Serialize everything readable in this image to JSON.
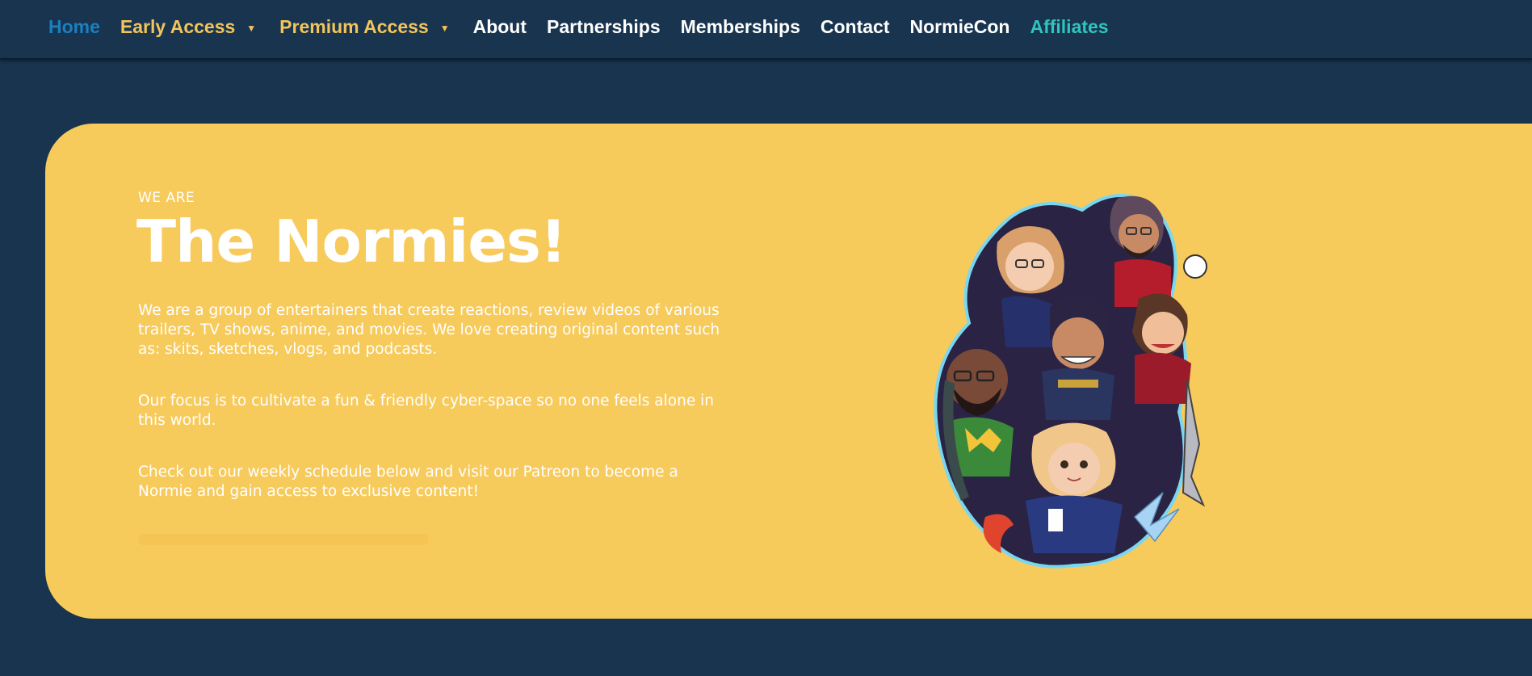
{
  "nav": {
    "home": "Home",
    "early_access": "Early Access",
    "premium_access": "Premium Access",
    "about": "About",
    "partnerships": "Partnerships",
    "memberships": "Memberships",
    "contact": "Contact",
    "normiecon": "NormieCon",
    "affiliates": "Affiliates",
    "caret": "▼"
  },
  "hero": {
    "eyebrow": "WE ARE",
    "title": "The Normies!",
    "paragraph_1": "We are a group of entertainers that create reactions, review videos of various trailers, TV shows, anime, and movies. We love creating original content such as: skits, sketches, vlogs, and podcasts.",
    "paragraph_2": "Our focus is to cultivate a fun & friendly cyber-space so no one feels alone in this world.",
    "paragraph_3": "Check out our weekly schedule below and visit our Patreon to become a Normie and gain access to exclusive content!"
  },
  "colors": {
    "background": "#18344f",
    "hero": "#f7ca5c",
    "nav_home": "#1b7fc0",
    "nav_gold": "#f2c45b",
    "nav_teal": "#2fc4bf"
  }
}
